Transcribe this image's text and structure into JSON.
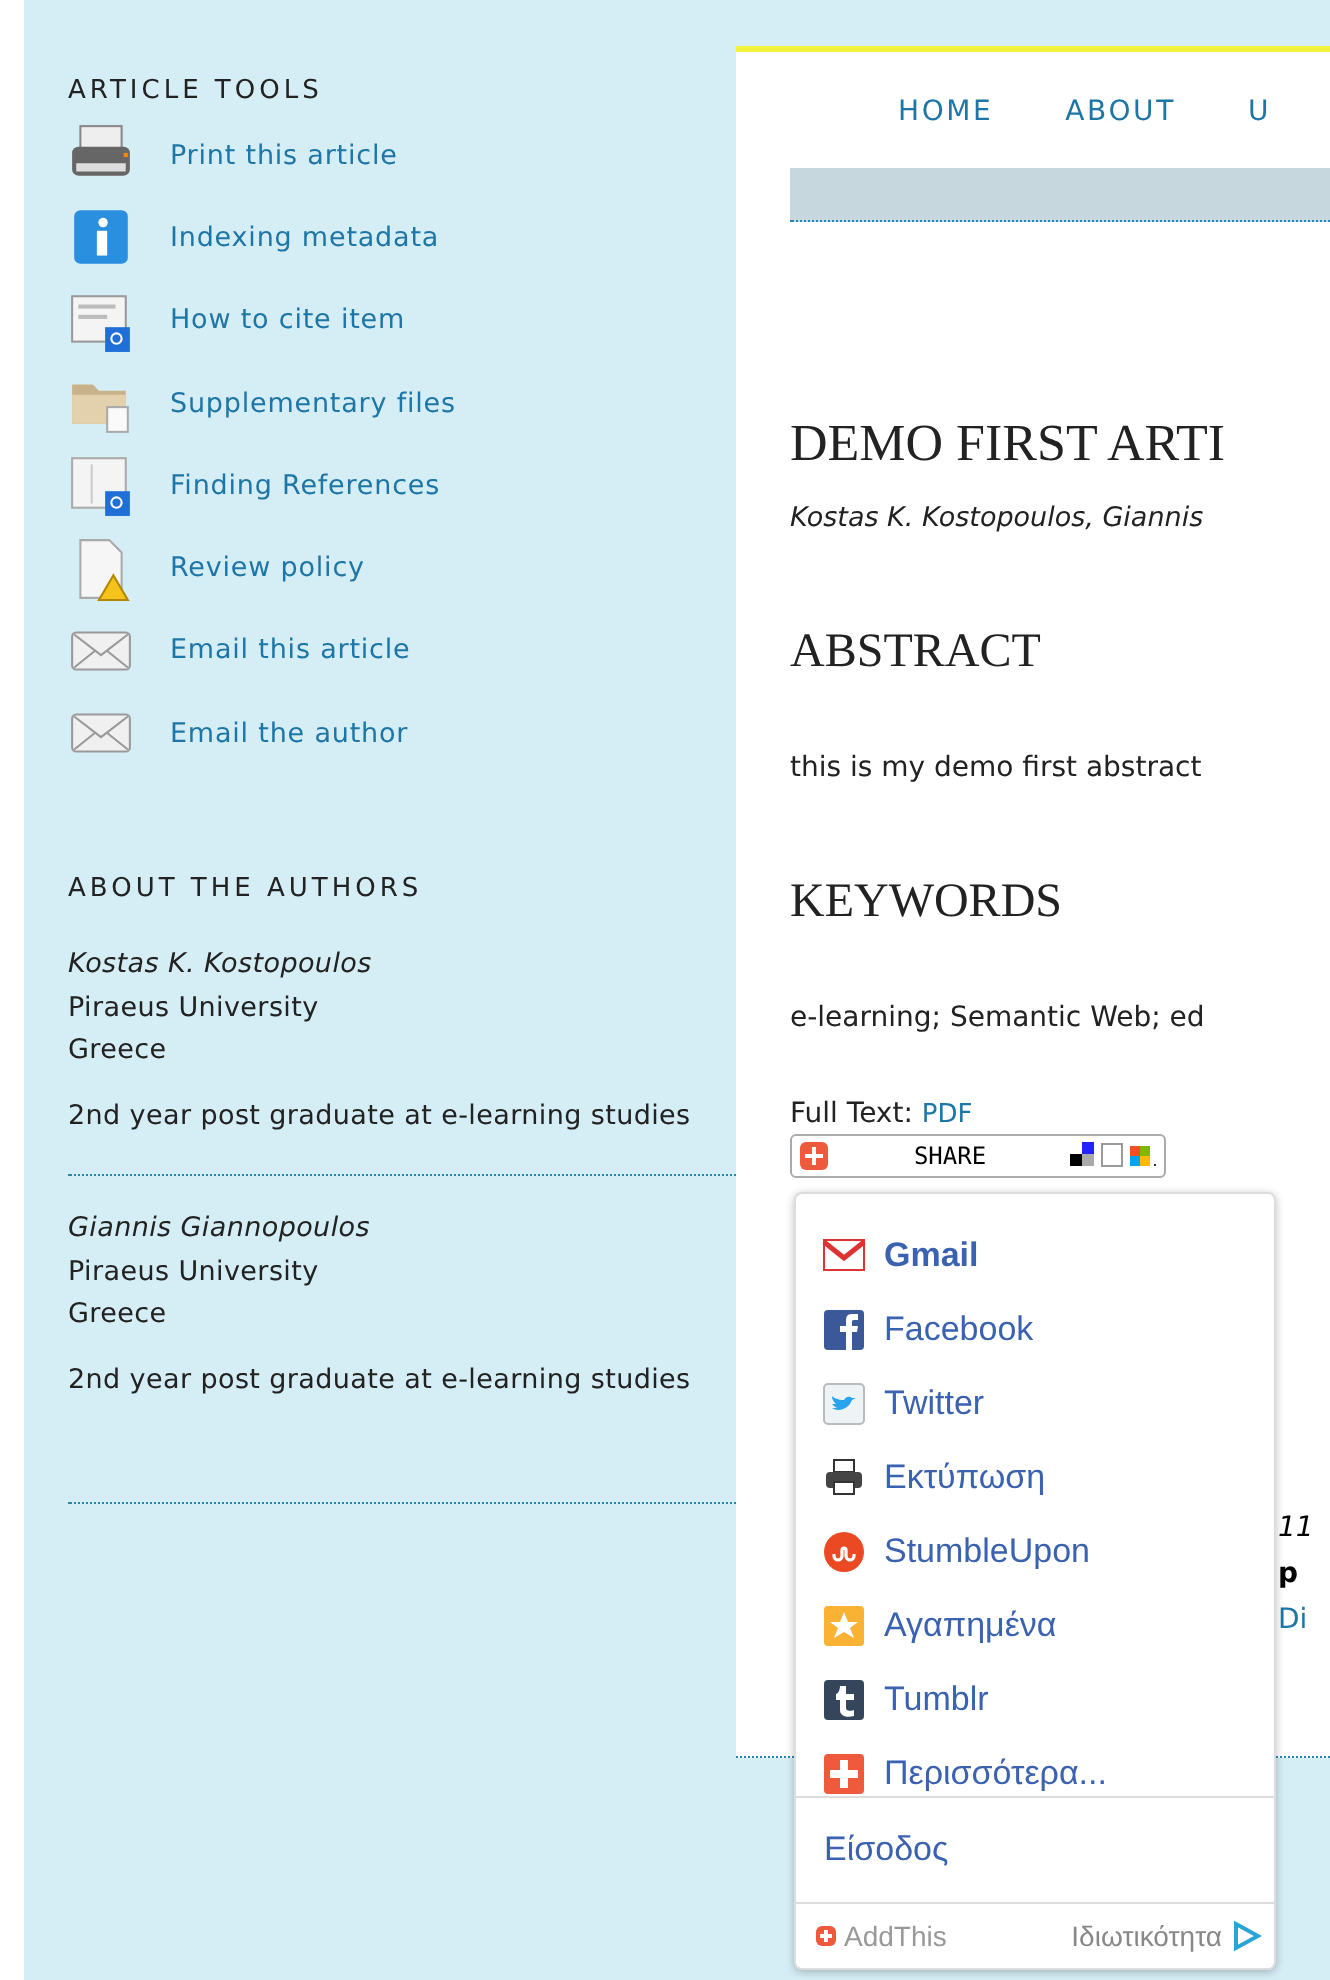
{
  "sidebar": {
    "article_tools": {
      "title": "ARTICLE TOOLS",
      "items": [
        {
          "label": "Print this article"
        },
        {
          "label": "Indexing metadata"
        },
        {
          "label": "How to cite item"
        },
        {
          "label": "Supplementary files"
        },
        {
          "label": "Finding References"
        },
        {
          "label": "Review policy"
        },
        {
          "label": "Email this article"
        },
        {
          "label": "Email the author"
        }
      ]
    },
    "about_authors": {
      "title": "ABOUT THE AUTHORS",
      "authors": [
        {
          "name": "Kostas K. Kostopoulos",
          "affiliation": "Piraeus University",
          "country": "Greece",
          "bio": "2nd year post graduate at e-learning studies"
        },
        {
          "name": "Giannis Giannopoulos",
          "affiliation": "Piraeus University",
          "country": "Greece",
          "bio": "2nd year post graduate at e-learning studies"
        }
      ]
    }
  },
  "main": {
    "nav": [
      "HOME",
      "ABOUT",
      "U"
    ],
    "title": "DEMO FIRST ARTI",
    "authors": "Kostas K. Kostopoulos, Giannis",
    "abstract": {
      "heading": "ABSTRACT",
      "text": "this is my demo first abstract"
    },
    "keywords": {
      "heading": "KEYWORDS",
      "text": "e-learning; Semantic Web; ed"
    },
    "full_text": {
      "label": "Full Text:",
      "link": "PDF"
    },
    "share_button": {
      "label": "SHARE"
    },
    "hidden_lines": [
      {
        "kind": "italic",
        "text": "11"
      },
      {
        "kind": "bold",
        "text": "p"
      },
      {
        "kind": "link",
        "text": "Di"
      }
    ]
  },
  "share_menu": {
    "items": [
      {
        "label": "Gmail"
      },
      {
        "label": "Facebook"
      },
      {
        "label": "Twitter"
      },
      {
        "label": "Εκτύπωση"
      },
      {
        "label": "StumbleUpon"
      },
      {
        "label": "Αγαπημένα"
      },
      {
        "label": "Tumblr"
      },
      {
        "label": "Περισσότερα..."
      }
    ],
    "sign_in": "Είσοδος",
    "footer": {
      "brand": "AddThis",
      "privacy": "Ιδιωτικότητα"
    }
  }
}
